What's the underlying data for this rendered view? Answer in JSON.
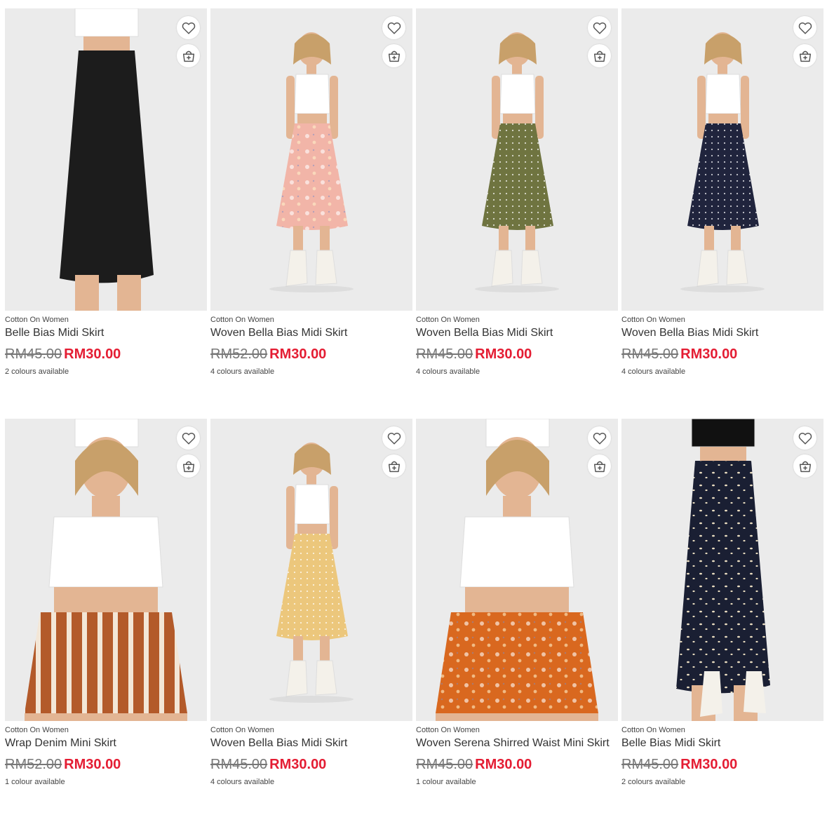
{
  "colors": {
    "sale_price": "#e41d33",
    "original_price": "#777777",
    "image_background": "#ebebeb"
  },
  "icons": {
    "wishlist": "heart-icon",
    "quick_add": "add-to-bag-icon"
  },
  "products": [
    {
      "brand": "Cotton On Women",
      "name": "Belle Bias Midi Skirt",
      "original_price": "RM45.00",
      "sale_price": "RM30.00",
      "colours": "2 colours available",
      "top_color": "#ffffff",
      "skirt_color": "#1c1c1c",
      "skirt_pattern": "solid"
    },
    {
      "brand": "Cotton On Women",
      "name": "Woven Bella Bias Midi Skirt",
      "original_price": "RM52.00",
      "sale_price": "RM30.00",
      "colours": "4 colours available",
      "top_color": "#ffffff",
      "skirt_color": "#f2b5a8",
      "skirt_pattern": "floral"
    },
    {
      "brand": "Cotton On Women",
      "name": "Woven Bella Bias Midi Skirt",
      "original_price": "RM45.00",
      "sale_price": "RM30.00",
      "colours": "4 colours available",
      "top_color": "#ffffff",
      "skirt_color": "#6f7440",
      "skirt_pattern": "dots"
    },
    {
      "brand": "Cotton On Women",
      "name": "Woven Bella Bias Midi Skirt",
      "original_price": "RM45.00",
      "sale_price": "RM30.00",
      "colours": "4 colours available",
      "top_color": "#ffffff",
      "skirt_color": "#20243d",
      "skirt_pattern": "dots"
    },
    {
      "brand": "Cotton On Women",
      "name": "Wrap Denim Mini Skirt",
      "original_price": "RM52.00",
      "sale_price": "RM30.00",
      "colours": "1 colour available",
      "top_color": "#ffffff",
      "skirt_color": "#b35a2a",
      "skirt_pattern": "stripes"
    },
    {
      "brand": "Cotton On Women",
      "name": "Woven Bella Bias Midi Skirt",
      "original_price": "RM45.00",
      "sale_price": "RM30.00",
      "colours": "4 colours available",
      "top_color": "#ffffff",
      "skirt_color": "#ecc77c",
      "skirt_pattern": "dots"
    },
    {
      "brand": "Cotton On Women",
      "name": "Woven Serena Shirred Waist Mini Skirt",
      "original_price": "RM45.00",
      "sale_price": "RM30.00",
      "colours": "1 colour available",
      "top_color": "#ffffff",
      "skirt_color": "#d9681f",
      "skirt_pattern": "floral"
    },
    {
      "brand": "Cotton On Women",
      "name": "Belle Bias Midi Skirt",
      "original_price": "RM45.00",
      "sale_price": "RM30.00",
      "colours": "2 colours available",
      "top_color": "#111111",
      "skirt_color": "#1a1f33",
      "skirt_pattern": "leopard"
    }
  ]
}
